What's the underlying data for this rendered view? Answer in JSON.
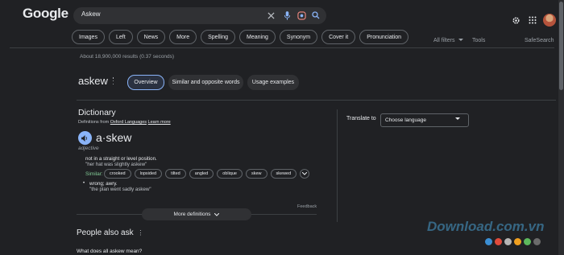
{
  "header": {
    "logo": "Google",
    "search_value": "Askew"
  },
  "chips": [
    "Images",
    "Left",
    "News",
    "More",
    "Spelling",
    "Meaning",
    "Synonym",
    "Cover it",
    "Pronunciation"
  ],
  "tools": {
    "all_filters": "All filters",
    "tools": "Tools",
    "safesearch": "SafeSearch"
  },
  "stats": "About 18,900,000 results (0.37 seconds)",
  "term": {
    "word": "askew",
    "tabs": [
      "Overview",
      "Similar and opposite words",
      "Usage examples"
    ]
  },
  "dictionary": {
    "title": "Dictionary",
    "source_prefix": "Definitions from",
    "source_name": "Oxford Languages",
    "learn_more": "Learn more",
    "headword": "a·skew",
    "pos": "adjective",
    "def1": "not in a straight or level position.",
    "ex1": "\"her hat was slightly askew\"",
    "similar_label": "Similar:",
    "synonyms": [
      "crooked",
      "lopsided",
      "tilted",
      "angled",
      "oblique",
      "skew",
      "skewed"
    ],
    "def2": "wrong; awry.",
    "ex2": "\"the plan went sadly askew\"",
    "feedback": "Feedback",
    "more_definitions": "More definitions"
  },
  "translate": {
    "label": "Translate to",
    "select": "Choose language"
  },
  "paa": {
    "title": "People also ask",
    "q1": "What does all askew mean?"
  },
  "watermark": {
    "text": "Download.com.vn",
    "dot_colors": [
      "#3b8fd4",
      "#e04b3c",
      "#b5b5b5",
      "#f0a020",
      "#5cb85c",
      "#6b6b6b"
    ]
  },
  "colors": {
    "background": "#202124",
    "accent": "#8ab4f8"
  }
}
